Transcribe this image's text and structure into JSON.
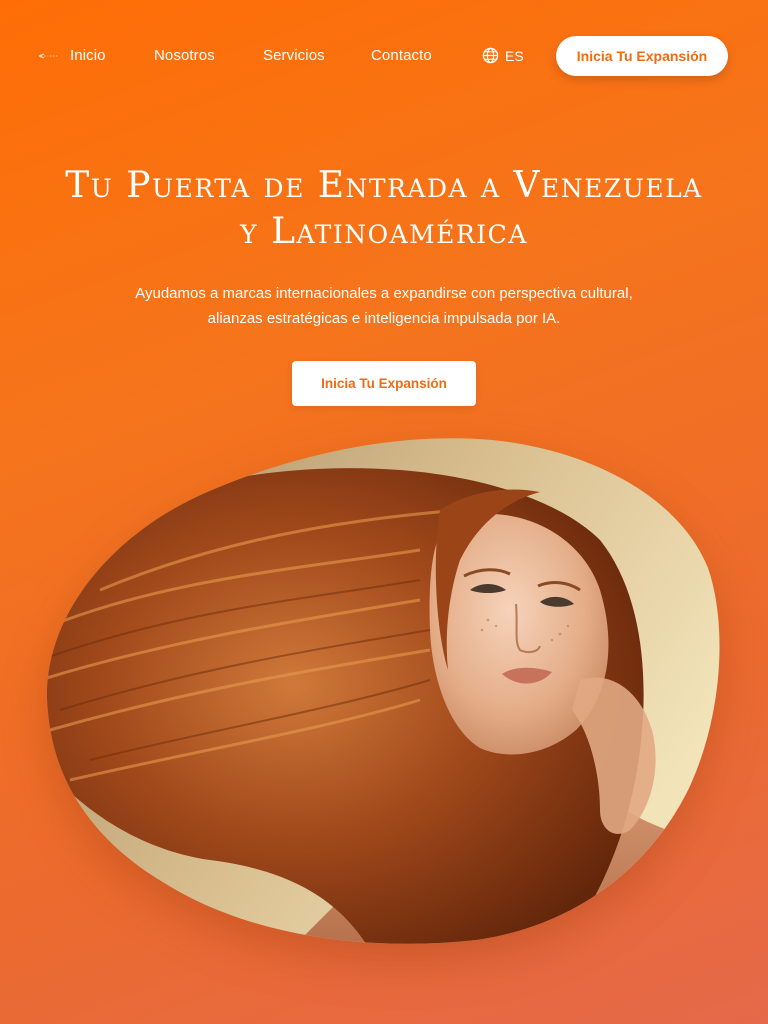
{
  "nav": {
    "links": [
      "Inicio",
      "Nosotros",
      "Servicios",
      "Contacto"
    ],
    "language": "ES",
    "cta_label": "Inicia Tu Expansión"
  },
  "hero": {
    "title_line1": "Tu Puerta de Entrada a Venezuela",
    "title_line2": "y Latinoamérica",
    "subtitle": "Ayudamos a marcas internacionales a expandirse con perspectiva cultural, alianzas estratégicas e inteligencia impulsada por IA.",
    "cta_label": "Inicia Tu Expansión"
  },
  "icons": {
    "logo": "brand-logo-icon",
    "language": "globe-icon"
  },
  "colors": {
    "brand_orange": "#ff6e06",
    "cta_text": "#f26a12",
    "white": "#ffffff"
  }
}
